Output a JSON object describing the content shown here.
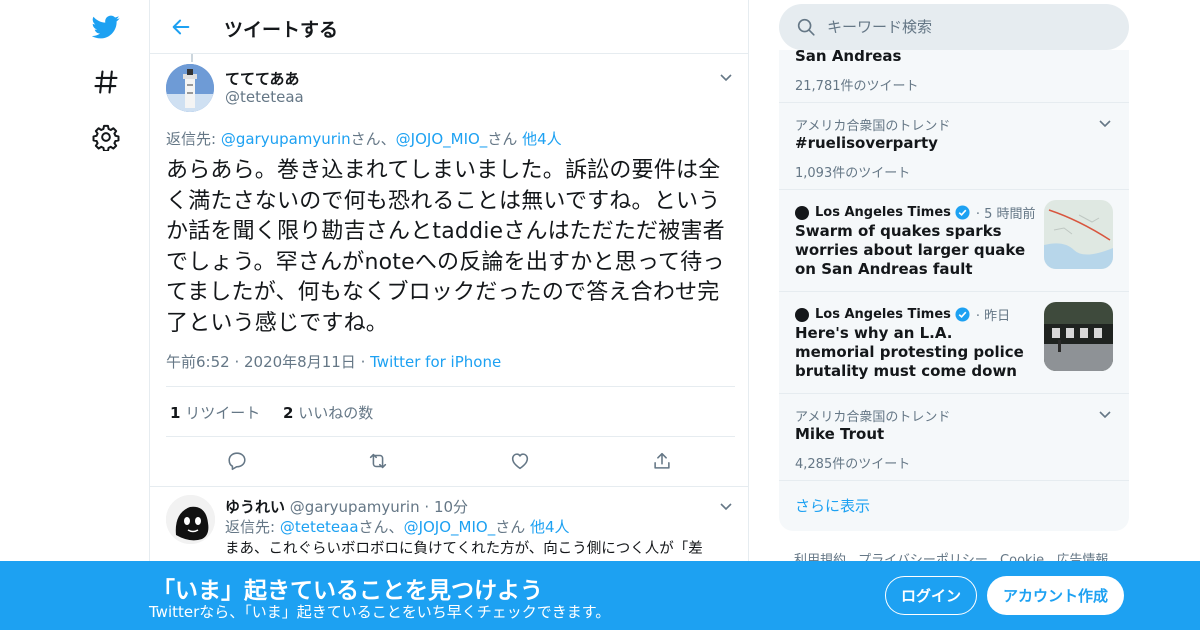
{
  "colors": {
    "accent": "#1da1f2",
    "text": "#14171a",
    "muted": "#657786",
    "border": "#e6ecf0"
  },
  "nav": {
    "icons": [
      "twitter-logo-icon",
      "hashtag-icon",
      "gear-icon"
    ]
  },
  "header": {
    "title": "ツイートする"
  },
  "tweet": {
    "display_name": "てててああ",
    "handle": "@teteteaa",
    "reply_prefix": "返信先: ",
    "reply_user1": "@garyupamyurin",
    "reply_sep1": "さん、",
    "reply_user2": "@JOJO_MIO_",
    "reply_sep2": "さん ",
    "reply_others": "他4人",
    "text": "あらあら。巻き込まれてしまいました。訴訟の要件は全く満たさないので何も恐れることは無いですね。というか話を聞く限り勘吉さんとtaddieさんはただただ被害者でしょう。罕さんがnoteへの反論を出すかと思って待ってましたが、何もなくブロックだったので答え合わせ完了という感じですね。",
    "time": "午前6:52",
    "date": "2020年8月11日",
    "source": "Twitter for iPhone",
    "retweet_count": "1",
    "retweet_label": "リツイート",
    "like_count": "2",
    "like_label": "いいねの数"
  },
  "reply_tweet": {
    "display_name": "ゆうれい",
    "handle": "@garyupamyurin",
    "age": "10分",
    "reply_prefix": "返信先: ",
    "reply_user1": "@teteteaa",
    "reply_sep1": "さん、",
    "reply_user2": "@JOJO_MIO_",
    "reply_sep2": "さん ",
    "reply_others": "他4人",
    "text": "まあ、これぐらいボロボロに負けてくれた方が、向こう側につく人が「差"
  },
  "search": {
    "placeholder": "キーワード検索"
  },
  "trends": [
    {
      "name": "San Andreas",
      "count": "21,781件のツイート"
    },
    {
      "context": "アメリカ合衆国のトレンド",
      "name": "#ruelisoverparty",
      "count": "1,093件のツイート"
    },
    {
      "context": "アメリカ合衆国のトレンド",
      "name": "Mike Trout",
      "count": "4,285件のツイート"
    }
  ],
  "news": [
    {
      "source": "Los Angeles Times",
      "time": "5 時間前",
      "headline": "Swarm of quakes sparks worries about larger quake on San Andreas fault",
      "thumb": "map-thumbnail"
    },
    {
      "source": "Los Angeles Times",
      "time": "昨日",
      "headline": "Here's why an L.A. memorial protesting police brutality must come down",
      "thumb": "street-photo-thumbnail"
    }
  ],
  "show_more": "さらに表示",
  "footer_links": [
    "利用規約",
    "プライバシーポリシー",
    "Cookie",
    "広告情報"
  ],
  "banner": {
    "title": "「いま」起きていることを見つけよう",
    "subtitle": "Twitterなら、「いま」起きていることをいち早くチェックできます。",
    "login": "ログイン",
    "signup": "アカウント作成"
  }
}
